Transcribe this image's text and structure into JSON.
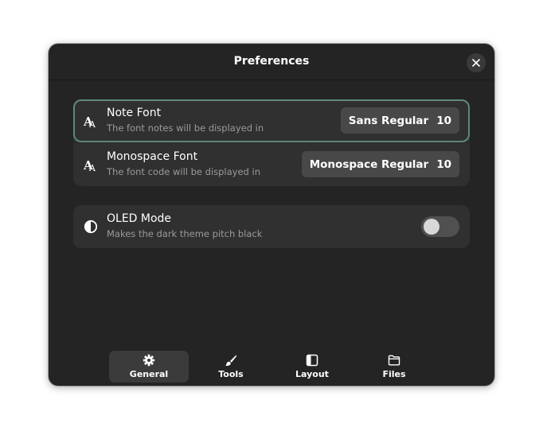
{
  "dialog": {
    "title": "Preferences",
    "close_icon": "close-icon"
  },
  "fonts_group": {
    "rows": [
      {
        "title": "Note Font",
        "subtitle": "The font notes will be displayed in",
        "font_name": "Sans Regular",
        "font_size": "10",
        "icon": "font-icon"
      },
      {
        "title": "Monospace Font",
        "subtitle": "The font code will be displayed in",
        "font_name": "Monospace Regular",
        "font_size": "10",
        "icon": "font-icon"
      }
    ]
  },
  "appearance_group": {
    "oled": {
      "title": "OLED Mode",
      "subtitle": "Makes the dark theme pitch black",
      "enabled": false,
      "icon": "contrast-icon"
    }
  },
  "nav": {
    "tabs": [
      {
        "label": "General",
        "icon": "gear-icon",
        "active": true
      },
      {
        "label": "Tools",
        "icon": "brush-icon",
        "active": false
      },
      {
        "label": "Layout",
        "icon": "layout-icon",
        "active": false
      },
      {
        "label": "Files",
        "icon": "folder-icon",
        "active": false
      }
    ]
  },
  "colors": {
    "dialog_bg": "#242424",
    "card_bg": "#303030",
    "focus_ring": "#5d8a76",
    "button_bg": "#484848"
  }
}
